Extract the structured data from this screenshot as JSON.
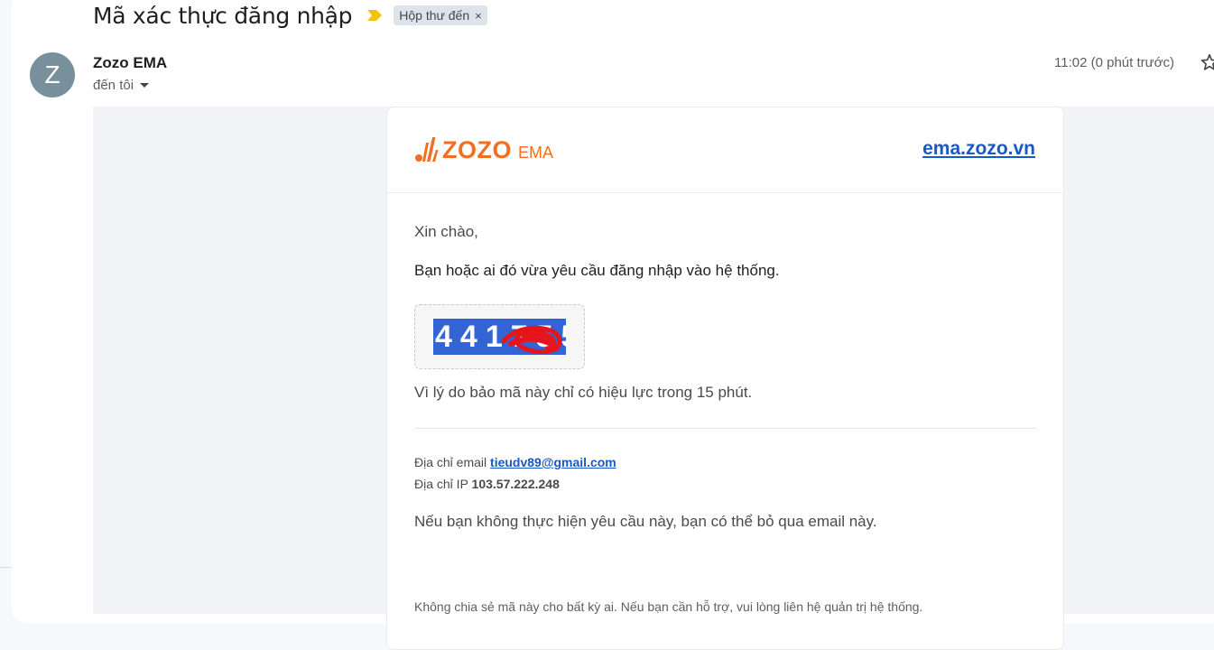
{
  "subject": {
    "title": "Mã xác thực đăng nhập",
    "label": "Hộp thư đến",
    "label_close": "×"
  },
  "sender": {
    "avatar_letter": "Z",
    "name": "Zozo EMA",
    "to": "đến tôi",
    "time": "11:02 (0 phút trước)"
  },
  "email": {
    "logo_brand": "ZOZO",
    "logo_sub": "EMA",
    "site_link": "ema.zozo.vn",
    "greeting": "Xin chào,",
    "request": "Bạn hoặc ai đó vừa yêu cầu đăng nhập vào hệ thống.",
    "code": "441755",
    "validity": "Vì lý do bảo mã này chỉ có hiệu lực trong 15 phút.",
    "email_label": "Địa chỉ email",
    "email_value": "tieudv89@gmail.com",
    "ip_label": "Địa chỉ IP",
    "ip_value": "103.57.222.248",
    "ignore": "Nếu bạn không thực hiện yêu cầu này, bạn có thể bỏ qua email này.",
    "footer_note": "Không chia sẻ mã này cho bất kỳ ai. Nếu bạn cần hỗ trợ, vui lòng liên hệ quản trị hệ thống."
  },
  "colors": {
    "brand_orange": "#f26f21",
    "link_blue": "#1a58c4",
    "code_highlight": "#3264d4",
    "redaction_red": "#e8141c",
    "important_yellow": "#f4c20d"
  },
  "icons": {
    "important": "important-marker-icon",
    "star": "star-icon",
    "caret": "caret-down-icon",
    "logo": "zozo-logo-icon"
  }
}
